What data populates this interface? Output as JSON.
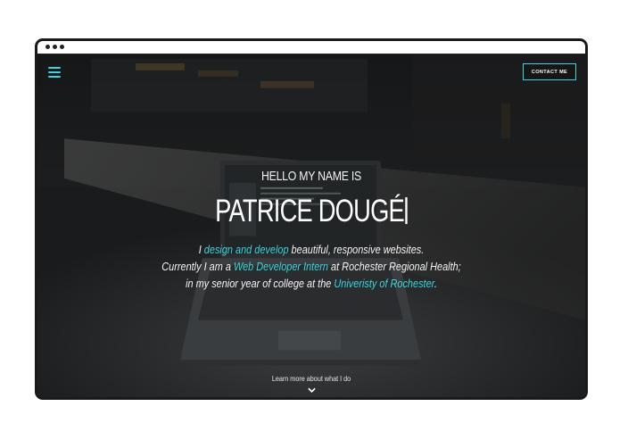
{
  "nav": {
    "menu_icon": "hamburger-icon",
    "contact_label": "CONTACT ME"
  },
  "hero": {
    "greeting": "HELLO MY NAME IS",
    "name": "PATRICE DOUGÉ",
    "bio": {
      "line1_pre": "I ",
      "line1_link": "design and develop",
      "line1_post": " beautiful, responsive websites.",
      "line2_pre": "Currently I am a ",
      "line2_link": "Web Developer Intern",
      "line2_post": " at Rochester Regional Health;",
      "line3_pre": "in my senior year of college at the ",
      "line3_link": "Univeristy of Rochester",
      "line3_post": "."
    }
  },
  "footer": {
    "learn_more": "Learn more about what I do",
    "chevron_icon": "chevron-down-icon"
  },
  "colors": {
    "accent": "#3ad6de",
    "background": "#1e2021",
    "text": "#ffffff"
  }
}
